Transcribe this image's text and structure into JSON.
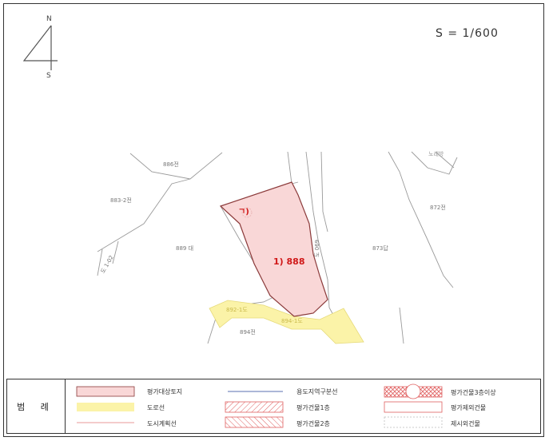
{
  "scale": {
    "text": "S = 1/600"
  },
  "compass": {
    "north": "N",
    "south": "S"
  },
  "parcels": [
    {
      "id": "p886",
      "label": "886전"
    },
    {
      "id": "p883",
      "label": "883-2전"
    },
    {
      "id": "p889",
      "label": "889 대"
    },
    {
      "id": "p873",
      "label": "873답"
    },
    {
      "id": "p872",
      "label": "872전"
    },
    {
      "id": "p892",
      "label": "892-1도"
    },
    {
      "id": "p894",
      "label": "894-1도"
    },
    {
      "id": "p894b",
      "label": "894전"
    },
    {
      "id": "road_v",
      "label": "도 069"
    },
    {
      "id": "road_left",
      "label": "도 1-02"
    },
    {
      "id": "topright",
      "label": "노래방"
    }
  ],
  "subject": {
    "label": "1) 888",
    "building": "ㄱ)"
  },
  "legend": {
    "title": "범 례",
    "items": [
      {
        "key": "subject_land",
        "label": "평가대상토지"
      },
      {
        "key": "land_use_line",
        "label": "용도지역구분선"
      },
      {
        "key": "building_3f",
        "label": "평가건물3층이상"
      },
      {
        "key": "road_line",
        "label": "도로선"
      },
      {
        "key": "building_1f",
        "label": "평가건물1층"
      },
      {
        "key": "excluded_building",
        "label": "평가제외건물"
      },
      {
        "key": "city_plan_line",
        "label": "도시계획선"
      },
      {
        "key": "building_2f",
        "label": "평가건물2층"
      },
      {
        "key": "proposed_building",
        "label": "제시외건물"
      }
    ]
  },
  "colors": {
    "subject_fill": "#f9d7d7",
    "subject_stroke": "#8b3a3a",
    "road_fill": "#fbf3a8",
    "parcel_line": "#9a9a9a",
    "land_use_line": "#5a6fb0",
    "city_plan_line": "#e89a9a",
    "hatch": "#e06060"
  }
}
